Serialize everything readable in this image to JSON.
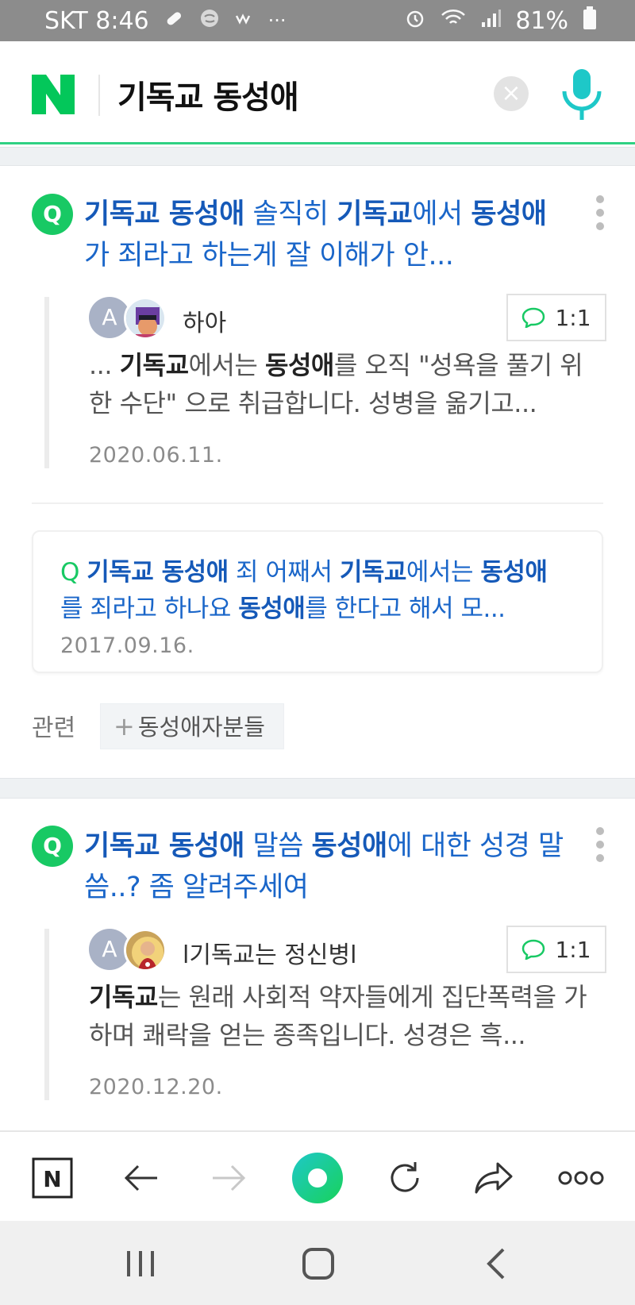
{
  "status_bar": {
    "carrier_time": "SKT 8:46",
    "battery": "81%",
    "left_icons": [
      "pill-icon",
      "brain-icon",
      "app-icon",
      "more-dots-icon"
    ],
    "right_icons": [
      "alarm-icon",
      "wifi-icon",
      "signal-icon",
      "battery-icon"
    ]
  },
  "search": {
    "logo": "N",
    "query": "기독교 동성애",
    "clear": "×"
  },
  "results": [
    {
      "title_parts": [
        {
          "text": "기독교 동성애",
          "bold": true
        },
        {
          "text": " 솔직히 ",
          "bold": false
        },
        {
          "text": "기독교",
          "bold": true
        },
        {
          "text": "에서 ",
          "bold": false
        },
        {
          "text": "동성애",
          "bold": true
        },
        {
          "text": "가 죄라고 하는게 잘 이해가 안...",
          "bold": false
        }
      ],
      "badge": "Q",
      "author": "하아",
      "avatar_letter": "A",
      "chat_label": "1:1",
      "snippet_parts": [
        {
          "text": "... ",
          "bold": false
        },
        {
          "text": "기독교",
          "bold": true
        },
        {
          "text": "에서는 ",
          "bold": false
        },
        {
          "text": "동성애",
          "bold": true
        },
        {
          "text": "를 오직 \"성욕을 풀기 위한 수단\" 으로 취급합니다. 성병을 옮기고...",
          "bold": false
        }
      ],
      "date": "2020.06.11.",
      "sub": {
        "badge": "Q",
        "title_parts": [
          {
            "text": "기독교 동성애",
            "bold": true
          },
          {
            "text": " 죄 어째서 ",
            "bold": false
          },
          {
            "text": "기독교",
            "bold": true
          },
          {
            "text": "에서는 ",
            "bold": false
          },
          {
            "text": "동성애",
            "bold": true
          },
          {
            "text": "를 죄라고 하나요 ",
            "bold": false
          },
          {
            "text": "동성애",
            "bold": true
          },
          {
            "text": "를 한다고 해서 모...",
            "bold": false
          }
        ],
        "date": "2017.09.16."
      },
      "related_label": "관련",
      "related_chip": "동성애자분들",
      "related_plus": "+"
    },
    {
      "title_parts": [
        {
          "text": "기독교 동성애",
          "bold": true
        },
        {
          "text": " 말씀 ",
          "bold": false
        },
        {
          "text": "동성애",
          "bold": true
        },
        {
          "text": "에 대한 성경 말씀..? 좀 알려주세여",
          "bold": false
        }
      ],
      "badge": "Q",
      "author": "l기독교는 정신병l",
      "avatar_letter": "A",
      "chat_label": "1:1",
      "snippet_parts": [
        {
          "text": "기독교",
          "bold": true
        },
        {
          "text": "는 원래 사회적 약자들에게 집단폭력을 가하며 쾌락을 얻는 종족입니다. 성경은 흑...",
          "bold": false
        }
      ],
      "date": "2020.12.20."
    }
  ],
  "toolbar": {
    "home_logo": "N",
    "icons": [
      "naver-home-icon",
      "back-arrow-icon",
      "forward-arrow-icon",
      "green-dot-icon",
      "refresh-icon",
      "share-icon",
      "more-icon"
    ]
  },
  "colors": {
    "naver_green": "#03c75a",
    "link_blue": "#1a66c9",
    "mic_teal": "#1ec8c8"
  }
}
